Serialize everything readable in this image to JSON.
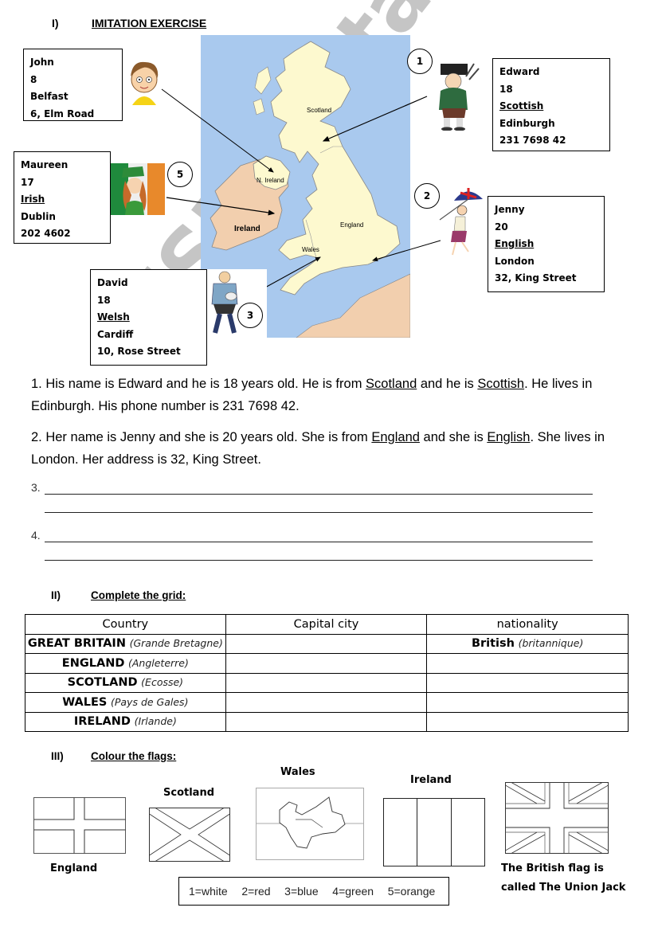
{
  "section1": {
    "number": "I)",
    "title": "IMITATION EXERCISE"
  },
  "cards": [
    {
      "id": "john",
      "name": "John",
      "age": "8",
      "city": "Belfast",
      "extra": "6, Elm Road"
    },
    {
      "id": "edward",
      "number": "1",
      "name": "Edward",
      "age": "18",
      "nationality": "Scottish",
      "city": "Edinburgh",
      "extra": "231 7698 42"
    },
    {
      "id": "maureen",
      "number": "5",
      "name": "Maureen",
      "age": "17",
      "nationality": "Irish",
      "city": "Dublin",
      "extra": "202 4602"
    },
    {
      "id": "jenny",
      "number": "2",
      "name": "Jenny",
      "age": "20",
      "nationality": "English",
      "city": "London",
      "extra": "32, King Street"
    },
    {
      "id": "david",
      "number": "3",
      "name": "David",
      "age": "18",
      "nationality": "Welsh",
      "city": "Cardiff",
      "extra": "10, Rose Street"
    }
  ],
  "map": {
    "labels": {
      "scotland": "Scotland",
      "n_ireland": "N. Ireland",
      "ireland": "Ireland",
      "wales": "Wales",
      "england": "England"
    },
    "colors": {
      "sea": "#a9c9ee",
      "uk": "#fdf9cf",
      "ireland": "#f2cfae",
      "france": "#f2cfae"
    }
  },
  "paragraphs": {
    "p1": {
      "a": "1. His name is Edward and he is 18 years old. He is from ",
      "u1": "Scotland",
      "b": " and he is ",
      "u2": "Scottish",
      "c": ". He lives in Edinburgh. His phone number is 231 7698 42."
    },
    "p2": {
      "a": "2. Her name is Jenny and she is 20 years old. She is from ",
      "u1": "England",
      "b": " and she is ",
      "u2": "English",
      "c": ". She lives in London. Her address is 32, King Street."
    }
  },
  "answer_lines": {
    "n3": "3.",
    "n4": "4."
  },
  "section2": {
    "number": "II)",
    "title": "Complete the grid:"
  },
  "grid": {
    "headers": [
      "Country",
      "Capital city",
      "nationality"
    ],
    "rows": [
      {
        "country": "GREAT BRITAIN",
        "country_fr": "(Grande Bretagne)",
        "capital": "",
        "nationality": "British",
        "nationality_fr": "(britannique)"
      },
      {
        "country": "ENGLAND",
        "country_fr": "(Angleterre)",
        "capital": "",
        "nationality": "",
        "nationality_fr": ""
      },
      {
        "country": "SCOTLAND",
        "country_fr": "(Ecosse)",
        "capital": "",
        "nationality": "",
        "nationality_fr": ""
      },
      {
        "country": "WALES",
        "country_fr": "(Pays de Gales)",
        "capital": "",
        "nationality": "",
        "nationality_fr": ""
      },
      {
        "country": "IRELAND",
        "country_fr": "(Irlande)",
        "capital": "",
        "nationality": "",
        "nationality_fr": ""
      }
    ]
  },
  "section3": {
    "number": "III)",
    "title": "Colour the flags:"
  },
  "flags": {
    "england": "England",
    "scotland": "Scotland",
    "wales": "Wales",
    "ireland": "Ireland",
    "uk_caption_1": "The British flag is",
    "uk_caption_2": "called The Union Jack"
  },
  "colour_key": "1=white   2=red   3=blue   4=green   5=orange",
  "watermark": "ESLprintables.com"
}
